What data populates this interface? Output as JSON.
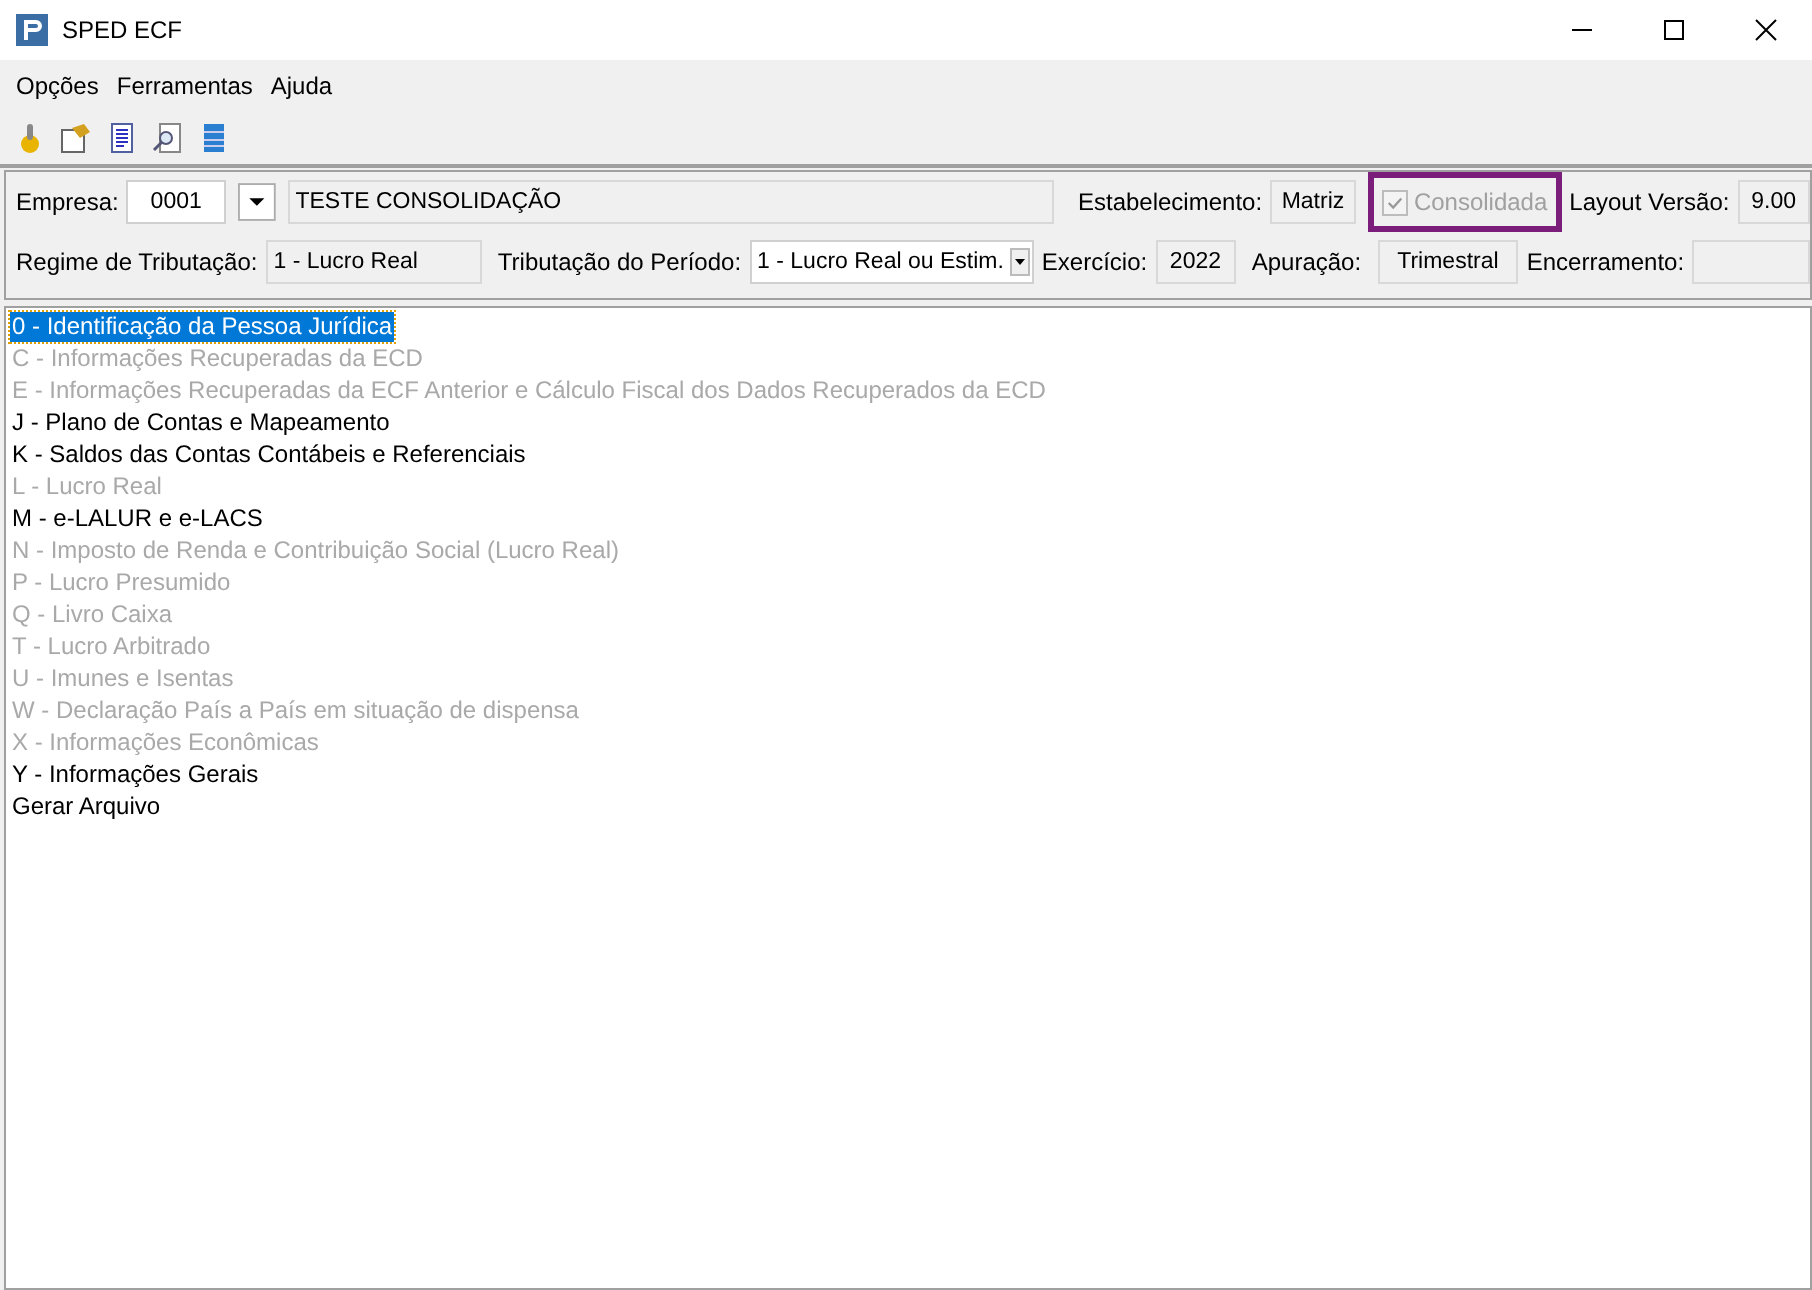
{
  "window": {
    "title": "SPED ECF"
  },
  "menu": [
    "Opções",
    "Ferramentas",
    "Ajuda"
  ],
  "header": {
    "empresa_label": "Empresa:",
    "empresa_code": "0001",
    "empresa_name": "TESTE CONSOLIDAÇÃO",
    "estabelecimento_label": "Estabelecimento:",
    "estabelecimento": "Matriz",
    "consolidada": {
      "label": "Consolidada",
      "checked": true,
      "disabled": true
    },
    "layout_label": "Layout Versão:",
    "layout": "9.00",
    "regime_label": "Regime de Tributação:",
    "regime": "1 - Lucro Real",
    "periodo_label": "Tributação do Período:",
    "periodo": "1 - Lucro Real ou Estim.",
    "exercicio_label": "Exercício:",
    "exercicio": "2022",
    "apuracao_label": "Apuração:",
    "apuracao": "Trimestral",
    "encerramento_label": "Encerramento:"
  },
  "items": [
    {
      "label": "0 - Identificação da Pessoa Jurídica",
      "disabled": false,
      "selected": true
    },
    {
      "label": "C - Informações Recuperadas da ECD",
      "disabled": true,
      "selected": false
    },
    {
      "label": "E - Informações Recuperadas da ECF Anterior e Cálculo Fiscal dos Dados Recuperados da ECD",
      "disabled": true,
      "selected": false
    },
    {
      "label": "J - Plano de Contas e Mapeamento",
      "disabled": false,
      "selected": false
    },
    {
      "label": "K - Saldos das Contas Contábeis e Referenciais",
      "disabled": false,
      "selected": false
    },
    {
      "label": "L - Lucro Real",
      "disabled": true,
      "selected": false
    },
    {
      "label": "M - e-LALUR e e-LACS",
      "disabled": false,
      "selected": false
    },
    {
      "label": "N - Imposto de Renda e Contribuição Social (Lucro Real)",
      "disabled": true,
      "selected": false
    },
    {
      "label": "P - Lucro Presumido",
      "disabled": true,
      "selected": false
    },
    {
      "label": "Q - Livro Caixa",
      "disabled": true,
      "selected": false
    },
    {
      "label": "T - Lucro Arbitrado",
      "disabled": true,
      "selected": false
    },
    {
      "label": "U - Imunes e Isentas",
      "disabled": true,
      "selected": false
    },
    {
      "label": "W - Declaração País a País em situação de dispensa",
      "disabled": true,
      "selected": false
    },
    {
      "label": "X - Informações Econômicas",
      "disabled": true,
      "selected": false
    },
    {
      "label": "Y - Informações Gerais",
      "disabled": false,
      "selected": false
    },
    {
      "label": "Gerar Arquivo",
      "disabled": false,
      "selected": false
    }
  ]
}
